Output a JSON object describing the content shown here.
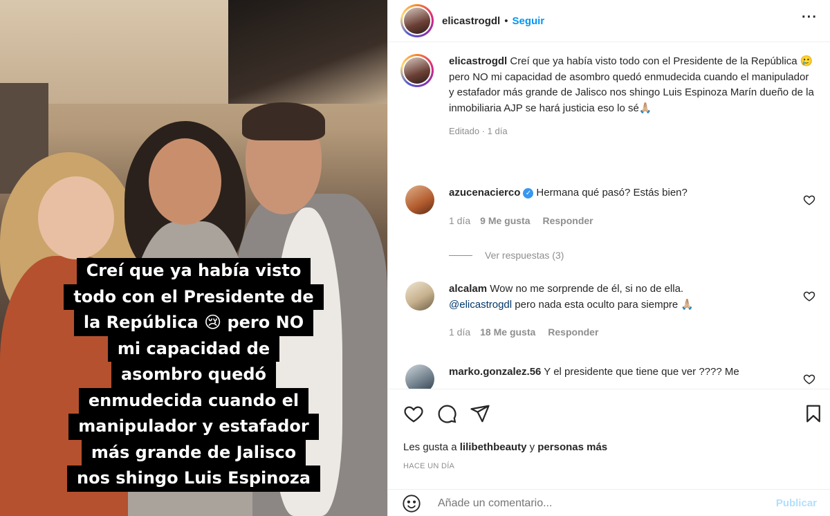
{
  "story_caption": {
    "lines": [
      "Creí que ya había visto",
      "todo con el Presidente de",
      "la República 😢 pero NO",
      "mi capacidad de",
      "asombro quedó",
      "enmudecida cuando el",
      "manipulador y estafador",
      "más grande de Jalisco",
      "nos shingo Luis Espinoza"
    ]
  },
  "header": {
    "username": "elicastrogdl",
    "separator": "•",
    "follow_label": "Seguir",
    "more_label": "···"
  },
  "post": {
    "username": "elicastrogdl",
    "caption": "Creí que ya había visto todo con el Presidente de la República 🥲 pero NO mi capacidad de asombro quedó enmudecida cuando el manipulador y estafador más grande de Jalisco nos shingo Luis Espinoza Marín dueño de la inmobiliaria AJP se hará justicia eso lo sé🙏🏼",
    "edited_meta": "Editado · 1 día"
  },
  "comments": [
    {
      "username": "azucenacierco",
      "verified": true,
      "text": "Hermana qué pasó? Estás bien?",
      "time": "1 día",
      "likes": "9 Me gusta",
      "reply_label": "Responder",
      "view_replies": "Ver respuestas (3)"
    },
    {
      "username": "alcalam",
      "text": "Wow no me sorprende de él, si no de ella.",
      "mention": "@elicastrogdl",
      "text2": "pero nada esta oculto para siempre 🙏🏼",
      "time": "1 día",
      "likes": "18 Me gusta",
      "reply_label": "Responder"
    },
    {
      "username": "marko.gonzalez.56",
      "text": "Y el presidente que tiene que ver ???? Me"
    }
  ],
  "likes_line": {
    "prefix": "Les gusta a",
    "user": "lilibethbeauty",
    "joiner": "y",
    "rest": "personas más"
  },
  "timestamp": "HACE UN DÍA",
  "add_comment": {
    "placeholder": "Añade un comentario...",
    "post_label": "Publicar"
  },
  "icons": {
    "like": "heart-icon",
    "comment": "comment-icon",
    "share": "share-icon",
    "save": "bookmark-icon",
    "emoji": "emoji-icon"
  },
  "colors": {
    "accent": "#0095f6",
    "muted": "#8e8e8e",
    "text": "#262626"
  }
}
